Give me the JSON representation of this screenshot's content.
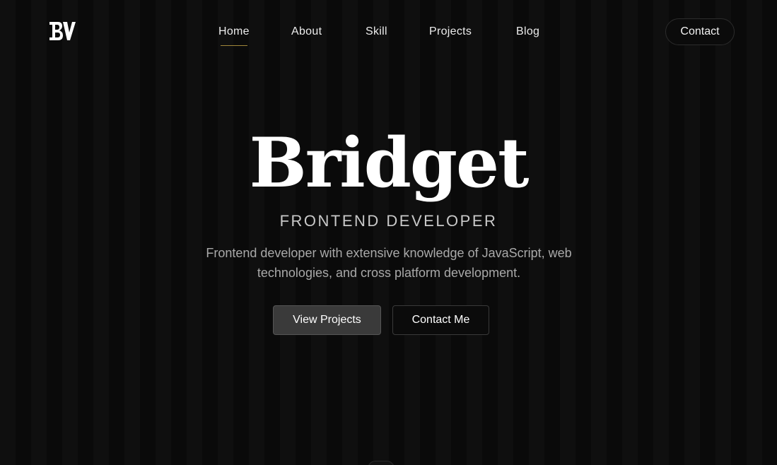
{
  "logo": {
    "text": "BV",
    "icon": "monogram-logo-icon"
  },
  "nav": {
    "items": [
      {
        "label": "Home",
        "active": true
      },
      {
        "label": "About",
        "active": false
      },
      {
        "label": "Skill",
        "active": false
      },
      {
        "label": "Projects",
        "active": false
      },
      {
        "label": "Blog",
        "active": false
      }
    ],
    "contact_label": "Contact"
  },
  "hero": {
    "name": "Bridget",
    "role": "FRONTEND DEVELOPER",
    "description": "Frontend developer with extensive knowledge of JavaScript, web technologies, and cross platform development.",
    "primary_button": "View Projects",
    "secondary_button": "Contact Me"
  },
  "colors": {
    "background": "#0a0a0a",
    "accent_underline": "#a0863a",
    "primary_button_bg": "#3a3a3a"
  }
}
